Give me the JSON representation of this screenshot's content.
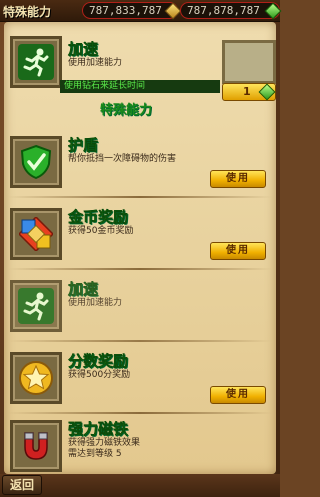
{
  "header": {
    "title": "特殊能力",
    "currency_gold": "787,833,787",
    "currency_gem": "787,878,787"
  },
  "special_slot": {
    "name": "加速",
    "desc": "使用加速能力",
    "banner": "使用钻石来延长时间",
    "gem_count": "1"
  },
  "section_title": "特殊能力",
  "items": [
    {
      "name": "护盾",
      "desc": "帮你抵挡一次障碍物的伤害",
      "button": "使用",
      "icon": "shield-icon",
      "has_button": true
    },
    {
      "name": "金币奖励",
      "desc": "获得50金币奖励",
      "button": "使用",
      "icon": "coin-bonus-icon",
      "has_button": true
    },
    {
      "name": "加速",
      "desc": "使用加速能力",
      "button": "",
      "icon": "runner-icon",
      "has_button": false
    },
    {
      "name": "分数奖励",
      "desc": "获得500分奖励",
      "button": "使用",
      "icon": "star-icon",
      "has_button": true
    },
    {
      "name": "强力磁铁",
      "desc": "获得强力磁铁效果",
      "desc2": "需达到等级 5",
      "button": "",
      "icon": "magnet-icon",
      "has_button": false
    }
  ],
  "footer": {
    "back": "返回"
  }
}
